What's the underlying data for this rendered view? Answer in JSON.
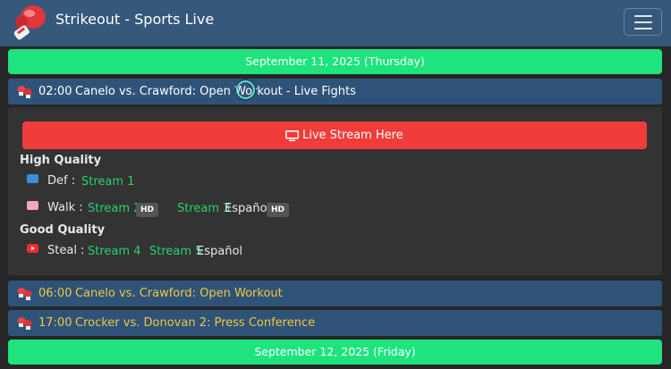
{
  "header": {
    "brand": "Strikeout - Sports Live",
    "icons": {
      "logo": "boxing-glove-icon",
      "menu": "hamburger-menu-icon"
    }
  },
  "schedule": [
    {
      "date": "September 11, 2025 (Thursday)",
      "events": [
        {
          "time": "02:00",
          "title": "Canelo vs. Crawford: Open Workout - Live Fights",
          "expanded": true,
          "live_button": "Live Stream Here",
          "quality_groups": [
            {
              "heading": "High Quality",
              "sources": [
                {
                  "label": "Def :",
                  "icon": "video-camera-icon",
                  "streams": [
                    {
                      "name": "Stream 1"
                    }
                  ]
                },
                {
                  "label": "Walk :",
                  "icon": "pink-player-icon",
                  "streams": [
                    {
                      "name": "Stream 2",
                      "badge": "HD"
                    },
                    {
                      "name": "Stream 3",
                      "lang": "Español",
                      "badge": "HD"
                    }
                  ]
                }
              ]
            },
            {
              "heading": "Good Quality",
              "sources": [
                {
                  "label": "Steal :",
                  "icon": "youtube-icon",
                  "streams": [
                    {
                      "name": "Stream 4"
                    },
                    {
                      "name": "Stream 5",
                      "lang": "Español"
                    }
                  ]
                }
              ]
            }
          ]
        },
        {
          "time": "06:00",
          "title": "Canelo vs. Crawford: Open Workout",
          "expanded": false
        },
        {
          "time": "17:00",
          "title": "Crocker vs. Donovan 2: Press Conference",
          "expanded": false
        }
      ]
    },
    {
      "date": "September 12, 2025 (Friday)",
      "events": []
    }
  ],
  "colors": {
    "navbar": "#35587b",
    "date_bar": "#1ee37e",
    "event_row": "#2f5378",
    "live_button": "#f03c3a",
    "stream_link": "#27d36f",
    "upcoming_text": "#f0c640"
  }
}
